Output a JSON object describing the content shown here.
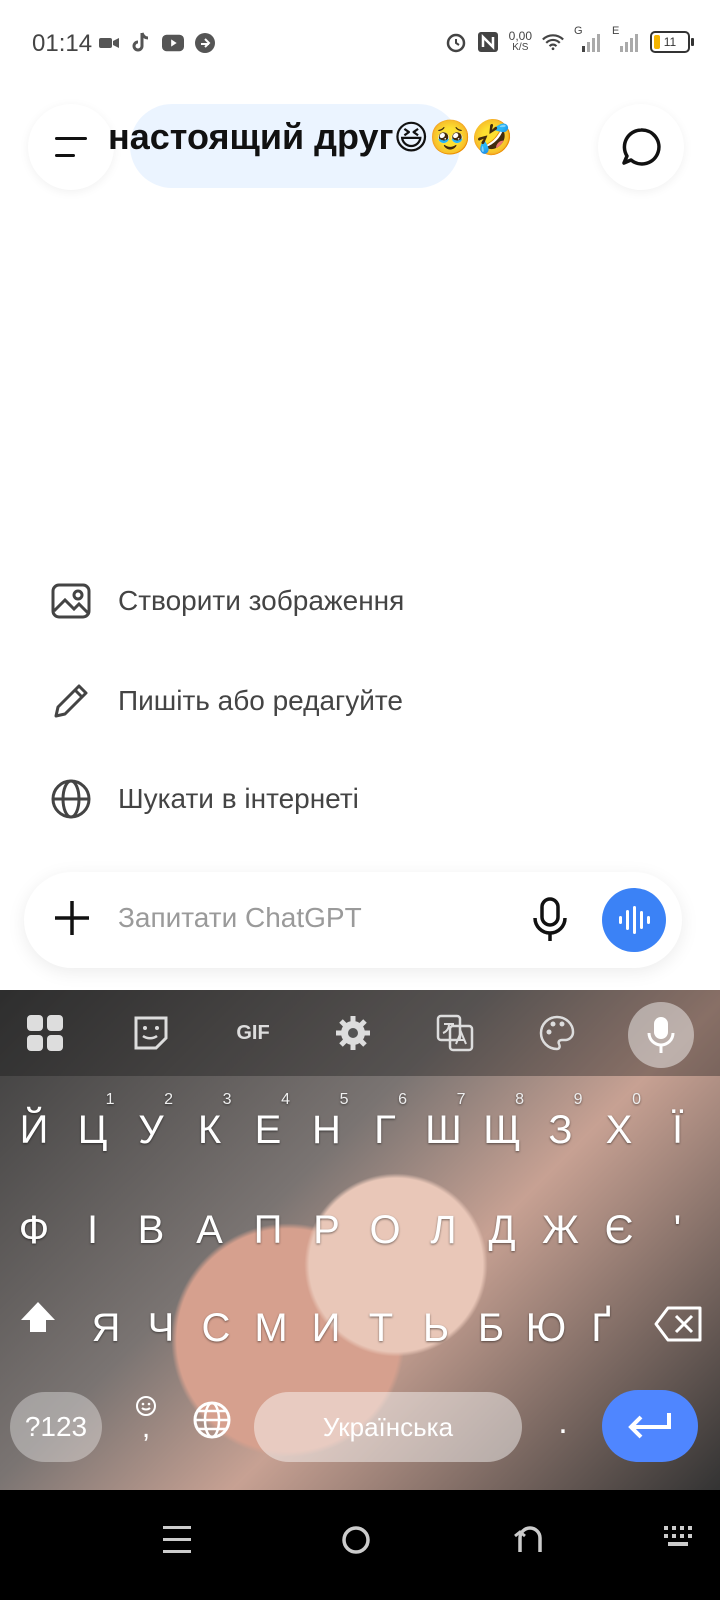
{
  "status": {
    "time": "01:14",
    "net_speed_value": "0,00",
    "net_speed_unit": "K/S",
    "network1": "G",
    "network2": "E",
    "battery": "11"
  },
  "header": {
    "title": "настоящий друг",
    "title_emojis": "😆🥹🤣"
  },
  "suggestions": [
    {
      "label": "Створити зображення",
      "icon": "image-icon"
    },
    {
      "label": "Пишіть або редагуйте",
      "icon": "pencil-icon"
    },
    {
      "label": "Шукати в інтернеті",
      "icon": "globe-icon"
    }
  ],
  "input": {
    "placeholder": "Запитати ChatGPT"
  },
  "keyboard": {
    "toolbar": {
      "gif": "GIF"
    },
    "row1": [
      "Й",
      "Ц",
      "У",
      "К",
      "Е",
      "Н",
      "Г",
      "Ш",
      "Щ",
      "З",
      "Х",
      "Ї"
    ],
    "row1_hints": [
      "",
      "1",
      "2",
      "3",
      "4",
      "5",
      "6",
      "7",
      "8",
      "9",
      "0",
      ""
    ],
    "row2": [
      "Ф",
      "І",
      "В",
      "А",
      "П",
      "Р",
      "О",
      "Л",
      "Д",
      "Ж",
      "Є",
      "'"
    ],
    "row3": [
      "Я",
      "Ч",
      "С",
      "М",
      "И",
      "Т",
      "Ь",
      "Б",
      "Ю",
      "Ґ"
    ],
    "sym_label": "?123",
    "emoji_comma": ",",
    "space_label": "Українська",
    "period": "."
  },
  "colors": {
    "accent_blue": "#3b82f6",
    "enter_blue": "#4f86ff",
    "battery_yellow": "#f4b400"
  }
}
